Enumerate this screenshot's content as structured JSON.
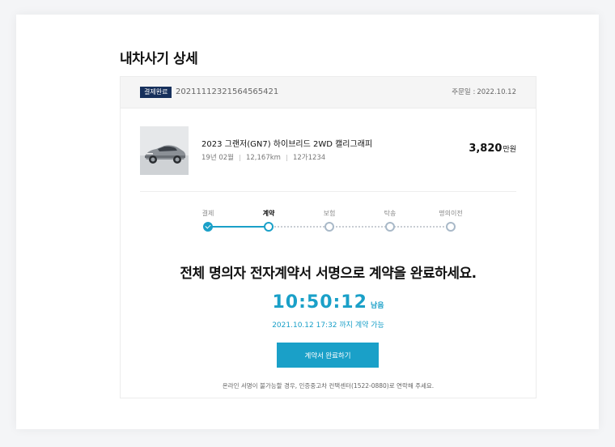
{
  "page": {
    "title": "내차사기 상세"
  },
  "order": {
    "badge": "결제완료",
    "number": "20211112321564565421",
    "date_label": "주문일 :",
    "date": "2022.10.12"
  },
  "car": {
    "name": "2023 그랜저(GN7) 하이브리드 2WD 캘리그래피",
    "year": "19년 02월",
    "mileage": "12,167km",
    "plate": "12가1234",
    "price": "3,820",
    "price_unit": "만원"
  },
  "steps": [
    {
      "label": "결제",
      "status": "done"
    },
    {
      "label": "계약",
      "status": "current"
    },
    {
      "label": "보험",
      "status": "todo"
    },
    {
      "label": "탁송",
      "status": "todo"
    },
    {
      "label": "명의이전",
      "status": "todo"
    }
  ],
  "contract": {
    "headline": "전체 명의자 전자계약서 서명으로 계약을 완료하세요.",
    "timer": "10:50:12",
    "timer_suffix": "남음",
    "deadline": "2021.10.12 17:32 까지 계약 가능",
    "button_label": "계약서 완료하기",
    "notice": "온라인 서명이 불가능할 경우, 인증중고차 컨택센터(1522-0880)로 연락해 주세요."
  },
  "colors": {
    "accent": "#1aa0c8",
    "badge": "#17305c"
  },
  "icons": {
    "step_done": "check-icon"
  }
}
